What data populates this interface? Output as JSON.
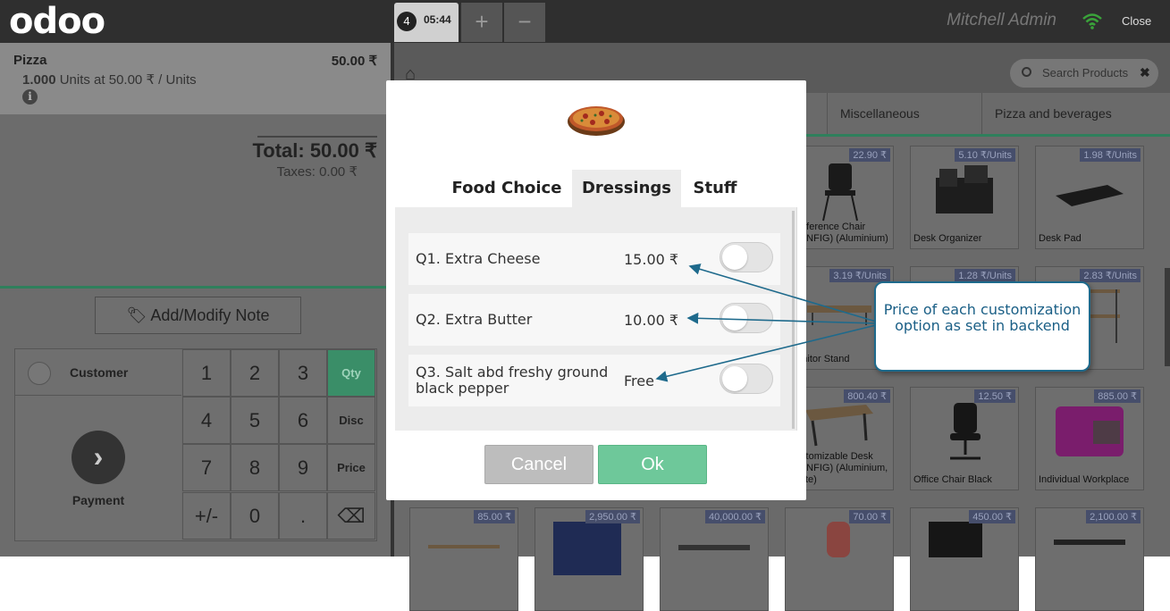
{
  "header": {
    "logo": "odoo",
    "order_number": "4",
    "order_time": "05:44",
    "add_order": "+",
    "remove_order": "−",
    "user": "Mitchell Admin",
    "close": "Close"
  },
  "orderline": {
    "product": "Pizza",
    "price": "50.00 ₹",
    "qty": "1.000",
    "unit_info": "Units at 50.00 ₹ / Units",
    "info": "i"
  },
  "summary": {
    "total": "Total: 50.00 ₹",
    "taxes": "Taxes: 0.00 ₹"
  },
  "note_button": "Add/Modify Note",
  "customer_label": "Customer",
  "payment_label": "Payment",
  "numpad": {
    "keys": [
      "1",
      "2",
      "3",
      "4",
      "5",
      "6",
      "7",
      "8",
      "9",
      "+/-",
      "0",
      "."
    ],
    "modes": [
      "Qty",
      "Disc",
      "Price"
    ],
    "backspace": "⌫"
  },
  "search": {
    "placeholder": "Search Products",
    "clear": "✖"
  },
  "categories": [
    "Miscellaneous",
    "Pizza and beverages"
  ],
  "products": [
    {
      "name": "Conference Chair (CONFIG) (Aluminium)",
      "price": "22.90 ₹"
    },
    {
      "name": "Desk Organizer",
      "price": "5.10 ₹/Units"
    },
    {
      "name": "Desk Pad",
      "price": "1.98 ₹/Units"
    },
    {
      "name": "Monitor Stand",
      "price": "3.19 ₹/Units"
    },
    {
      "name": "",
      "price": "1.28 ₹/Units"
    },
    {
      "name": "",
      "price": "2.83 ₹/Units"
    },
    {
      "name": "Customizable Desk (CONFIG) (Aluminium, White)",
      "price": "800.40 ₹"
    },
    {
      "name": "Office Chair Black",
      "price": "12.50 ₹"
    },
    {
      "name": "Individual Workplace",
      "price": "885.00 ₹"
    },
    {
      "name": "",
      "price": "85.00 ₹"
    },
    {
      "name": "",
      "price": "2,950.00 ₹"
    },
    {
      "name": "",
      "price": "40,000.00 ₹"
    },
    {
      "name": "",
      "price": "70.00 ₹"
    },
    {
      "name": "",
      "price": "450.00 ₹"
    },
    {
      "name": "",
      "price": "2,100.00 ₹"
    }
  ],
  "popup": {
    "tabs": [
      "Food Choice",
      "Dressings",
      "Stuff"
    ],
    "active_tab": "Dressings",
    "options": [
      {
        "label": "Q1. Extra Cheese",
        "price": "15.00 ₹",
        "enabled": false
      },
      {
        "label": "Q2. Extra Butter",
        "price": "10.00 ₹",
        "enabled": false
      },
      {
        "label": "Q3. Salt abd freshy ground black pepper",
        "price": "Free",
        "enabled": false
      }
    ],
    "cancel": "Cancel",
    "ok": "Ok"
  },
  "callout": "Price of each customization option as set in backend",
  "colors": {
    "accent": "#6ec89a",
    "callout": "#1e6a8c",
    "header": "#2f2f2f"
  }
}
